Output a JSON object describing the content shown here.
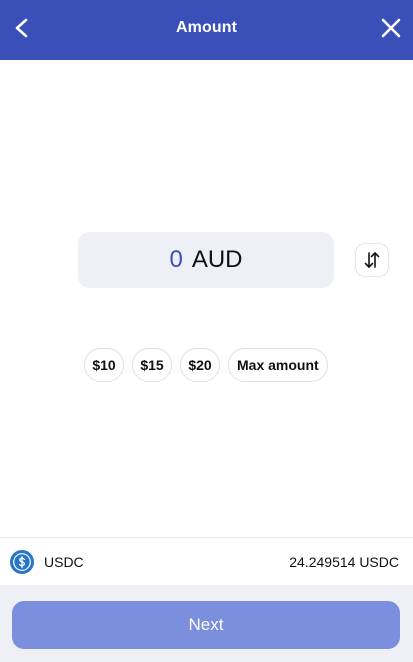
{
  "header": {
    "title": "Amount",
    "back_icon": "chevron-left-icon",
    "close_icon": "close-icon",
    "background_color": "#3b4fb8"
  },
  "amount": {
    "value": "0",
    "currency": "AUD",
    "value_color": "#3b4fb8"
  },
  "swap": {
    "icon": "swap-vertical-icon"
  },
  "presets": [
    {
      "label": "$10"
    },
    {
      "label": "$15"
    },
    {
      "label": "$20"
    },
    {
      "label": "Max amount"
    }
  ],
  "balance": {
    "token_icon": "usdc-icon",
    "token": "USDC",
    "amount": "24.249514 USDC",
    "token_color": "#2775ca"
  },
  "footer": {
    "next_label": "Next",
    "next_color": "#7c8ede"
  }
}
